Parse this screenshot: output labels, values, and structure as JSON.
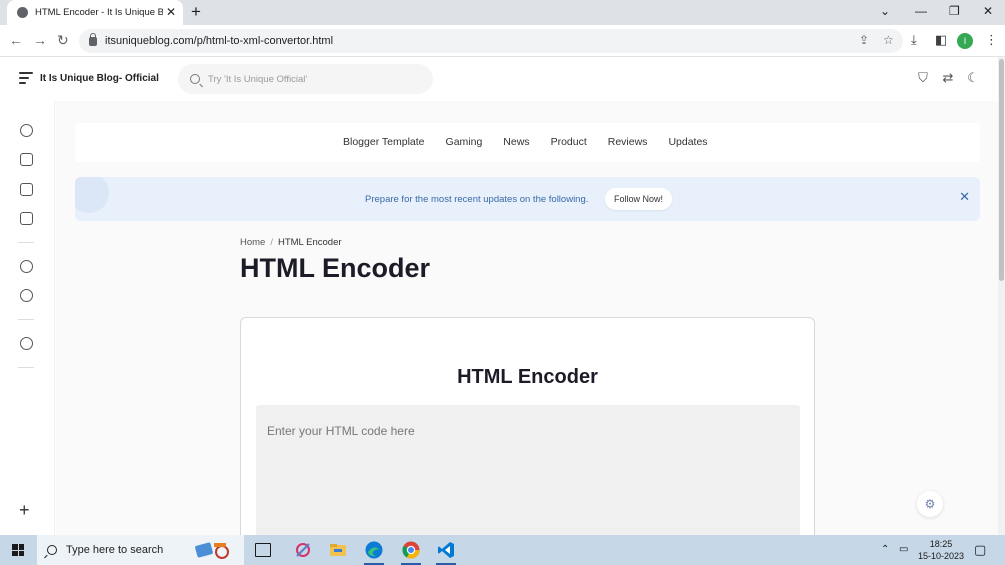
{
  "browser": {
    "tab_title": "HTML Encoder - It Is Unique Blog",
    "new_tab": "+",
    "url": "itsuniqueblog.com/p/html-to-xml-convertor.html",
    "profile_initial": "I"
  },
  "site": {
    "name": "It Is Unique Blog- Official",
    "search_placeholder": "Try 'It Is Unique Official'"
  },
  "nav": {
    "links": [
      "Blogger Template",
      "Gaming",
      "News",
      "Product",
      "Reviews",
      "Updates"
    ]
  },
  "banner": {
    "message": "Prepare for the most recent updates on the following.",
    "button": "Follow Now!"
  },
  "breadcrumb": {
    "home": "Home",
    "separator": "/",
    "current": "HTML Encoder"
  },
  "page": {
    "title": "HTML Encoder"
  },
  "tool": {
    "title": "HTML Encoder",
    "placeholder": "Enter your HTML code here"
  },
  "taskbar": {
    "search_placeholder": "Type here to search",
    "time": "18:25",
    "date": "15-10-2023"
  },
  "colors": {
    "banner_bg": "#e7f0fb",
    "banner_text": "#3a6aa8",
    "taskbar_bg": "#c6d7e8",
    "accent_vscode": "#0078d4",
    "accent_edge": "#0c7bd6"
  }
}
